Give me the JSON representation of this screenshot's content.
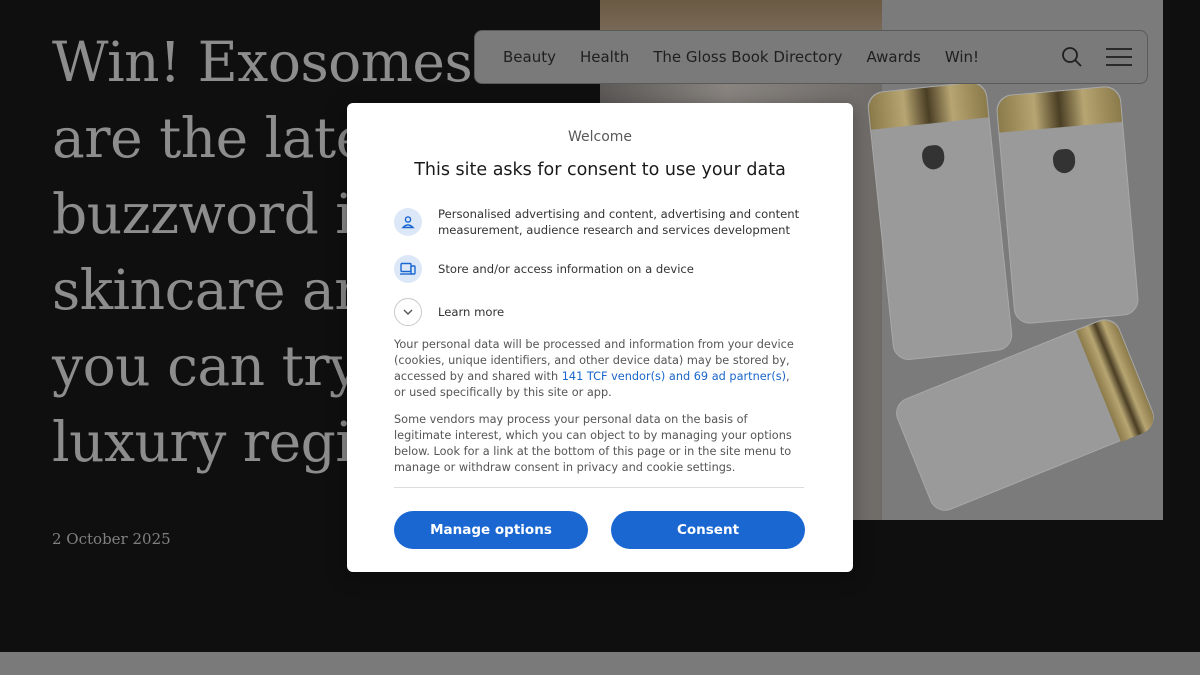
{
  "article": {
    "title": "Win! Exosomes\nare the latest\nbuzzword in\nskincare and\nyou can try a\nluxury regime",
    "date": "2 October 2025"
  },
  "nav": {
    "items": [
      "Beauty",
      "Health",
      "The Gloss Book Directory",
      "Awards",
      "Win!"
    ],
    "icons": [
      "search-icon",
      "menu-icon"
    ]
  },
  "consent": {
    "welcome": "Welcome",
    "heading": "This site asks for consent to use your data",
    "purposes": [
      {
        "icon": "person-icon",
        "text": "Personalised advertising and content, advertising and content measurement, audience research and services development"
      },
      {
        "icon": "devices-icon",
        "text": "Store and/or access information on a device"
      }
    ],
    "learn_more": "Learn more",
    "paragraph1_before": "Your personal data will be processed and information from your device (cookies, unique identifiers, and other device data) may be stored by, accessed by and shared with ",
    "paragraph1_link": "141 TCF vendor(s) and 69 ad partner(s)",
    "paragraph1_after": ", or used specifically by this site or app.",
    "paragraph2": "Some vendors may process your personal data on the basis of legitimate interest, which you can object to by managing your options below. Look for a link at the bottom of this page or in the site menu to manage or withdraw consent in privacy and cookie settings.",
    "manage_label": "Manage options",
    "consent_label": "Consent"
  },
  "colors": {
    "accent": "#1a67d2",
    "link": "#1a66c9",
    "icon_bg": "#dce8f7"
  }
}
